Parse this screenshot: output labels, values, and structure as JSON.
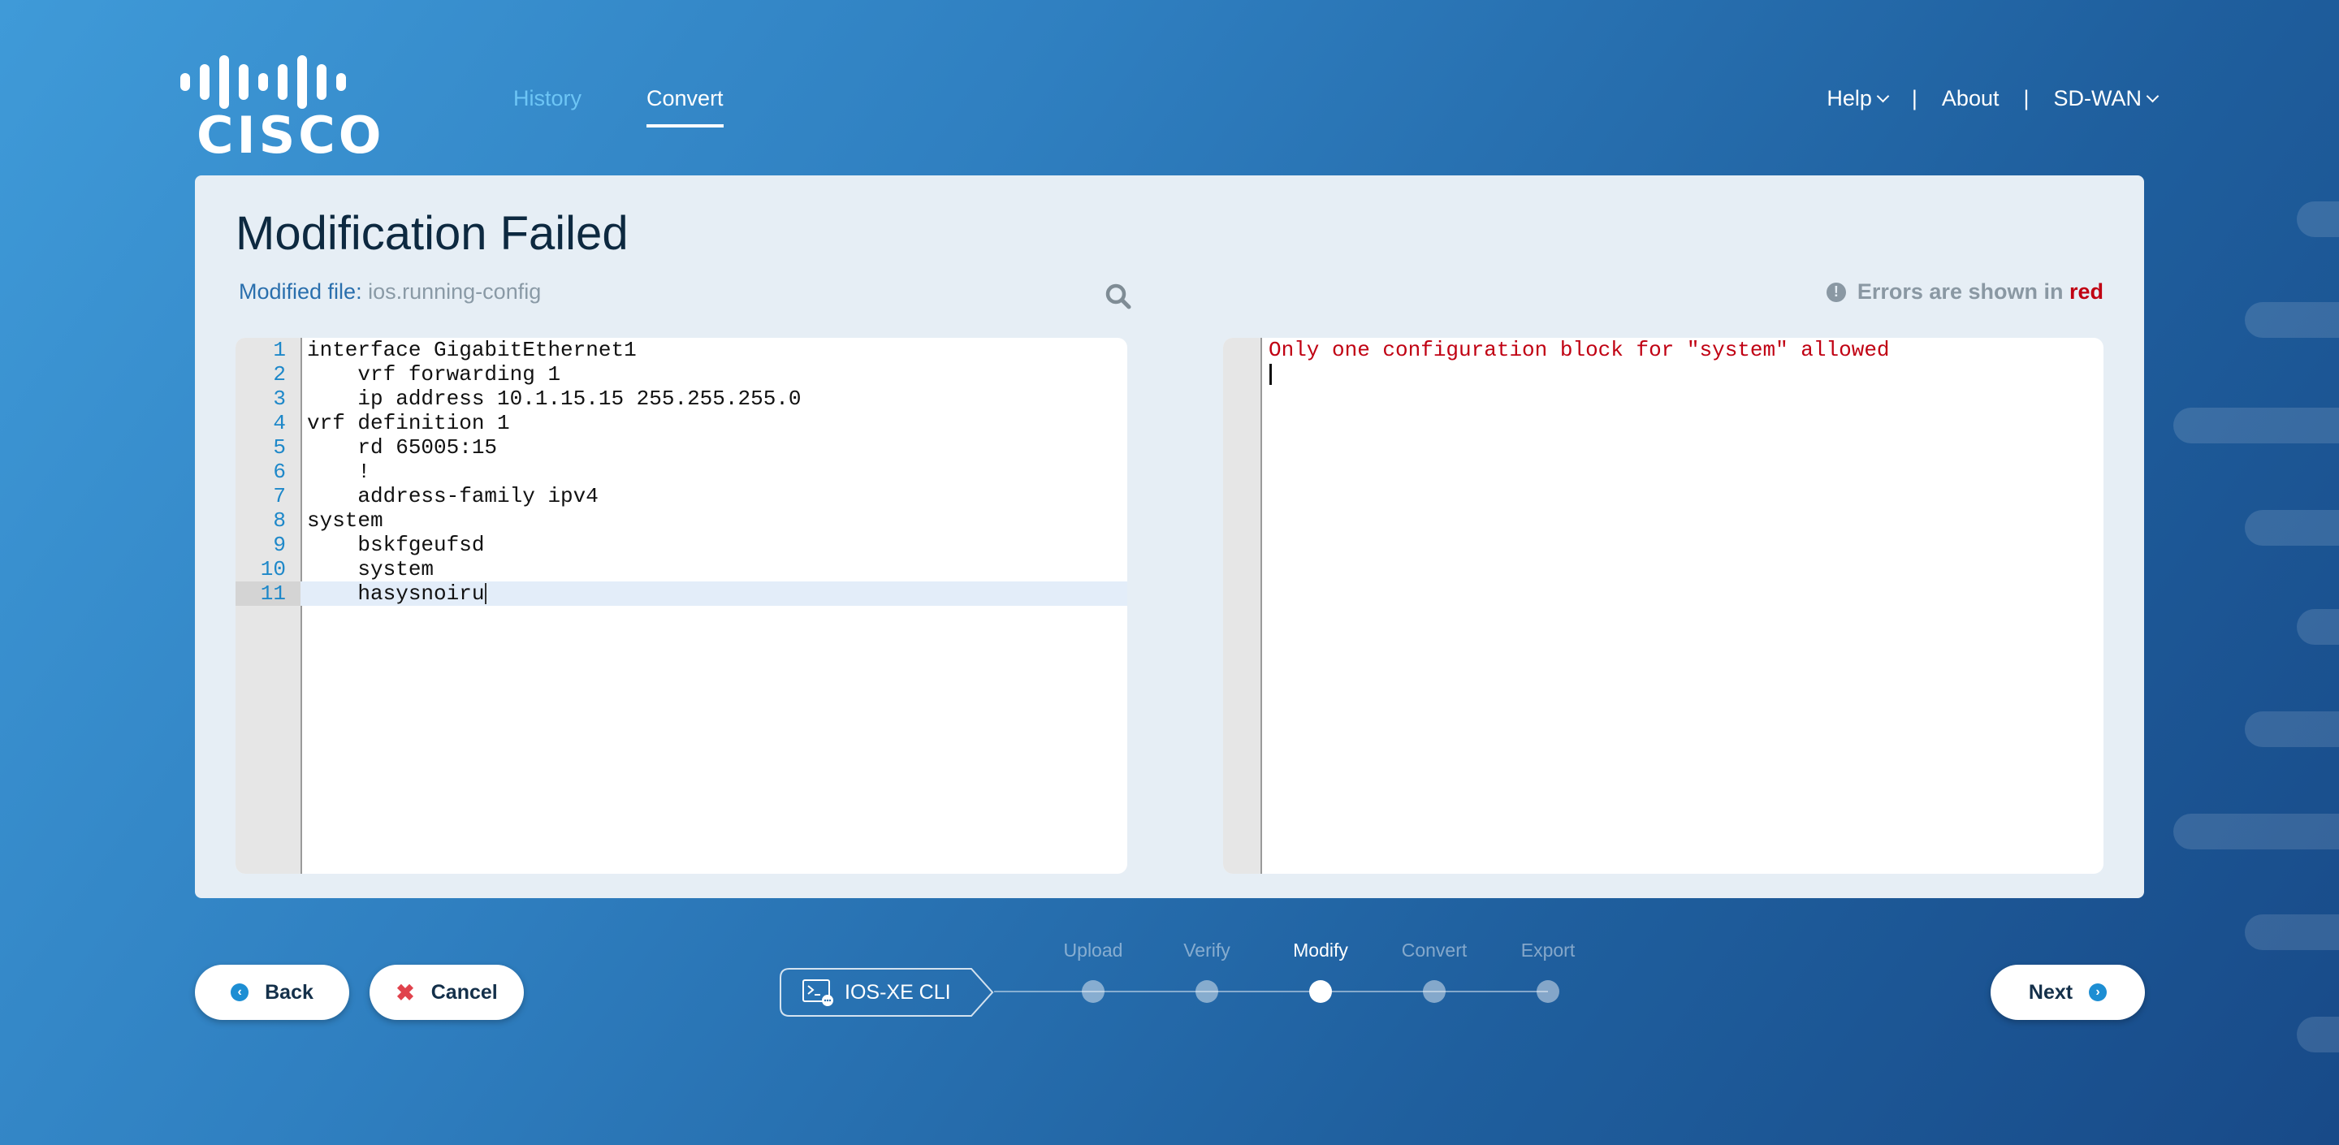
{
  "header": {
    "logo_text": "CISCO",
    "nav": [
      {
        "label": "History",
        "active": false
      },
      {
        "label": "Convert",
        "active": true
      }
    ],
    "right_menu": {
      "help": "Help",
      "separator": "|",
      "about": "About",
      "product": "SD-WAN"
    }
  },
  "main": {
    "title": "Modification Failed",
    "modified_file_label": "Modified file:",
    "modified_file_value": "ios.running-config",
    "error_hint_prefix": "Errors are shown in",
    "error_hint_color_word": "red",
    "search_icon": "search-icon",
    "editor": {
      "lines": [
        {
          "n": "1",
          "text": "interface GigabitEthernet1"
        },
        {
          "n": "2",
          "text": "    vrf forwarding 1"
        },
        {
          "n": "3",
          "text": "    ip address 10.1.15.15 255.255.255.0"
        },
        {
          "n": "4",
          "text": "vrf definition 1"
        },
        {
          "n": "5",
          "text": "    rd 65005:15"
        },
        {
          "n": "6",
          "text": "    !"
        },
        {
          "n": "7",
          "text": "    address-family ipv4"
        },
        {
          "n": "8",
          "text": "system"
        },
        {
          "n": "9",
          "text": "    bskfgeufsd"
        },
        {
          "n": "10",
          "text": "    system"
        },
        {
          "n": "11",
          "text": "    hasysnoiru"
        }
      ],
      "active_line": 11
    },
    "errors": {
      "messages": [
        "Only one configuration block for \"system\" allowed"
      ]
    }
  },
  "footer": {
    "back_label": "Back",
    "cancel_label": "Cancel",
    "next_label": "Next",
    "product_label": "IOS-XE CLI",
    "steps": [
      {
        "label": "Upload",
        "state": "done"
      },
      {
        "label": "Verify",
        "state": "done"
      },
      {
        "label": "Modify",
        "state": "current"
      },
      {
        "label": "Convert",
        "state": "pending"
      },
      {
        "label": "Export",
        "state": "pending"
      }
    ]
  },
  "colors": {
    "accent": "#1d8ed3",
    "error": "#c00012",
    "nav_inactive": "#6dc5f5"
  }
}
